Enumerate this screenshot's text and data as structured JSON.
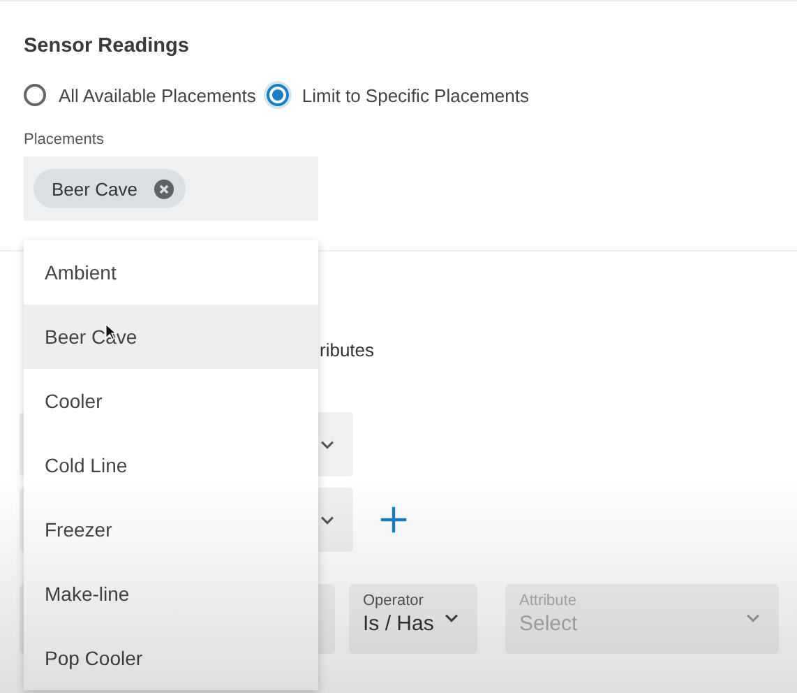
{
  "section": {
    "title": "Sensor Readings"
  },
  "scope_options": [
    {
      "label": "All Available Placements",
      "selected": false
    },
    {
      "label": "Limit to Specific Placements",
      "selected": true
    }
  ],
  "placements": {
    "label": "Placements",
    "chips": [
      {
        "label": "Beer Cave"
      }
    ]
  },
  "dropdown": {
    "options": [
      {
        "label": "Ambient",
        "highlighted": false
      },
      {
        "label": "Beer Cave",
        "highlighted": true
      },
      {
        "label": "Cooler",
        "highlighted": false
      },
      {
        "label": "Cold Line",
        "highlighted": false
      },
      {
        "label": "Freezer",
        "highlighted": false
      },
      {
        "label": "Make-line",
        "highlighted": false
      },
      {
        "label": "Pop Cooler",
        "highlighted": false
      }
    ]
  },
  "background": {
    "partial_text": "ributes",
    "filters": [
      {
        "label": "Operator",
        "value": "Is / Has",
        "disabled": false
      },
      {
        "label": "Attribute",
        "value": "Select",
        "disabled": true
      }
    ]
  }
}
